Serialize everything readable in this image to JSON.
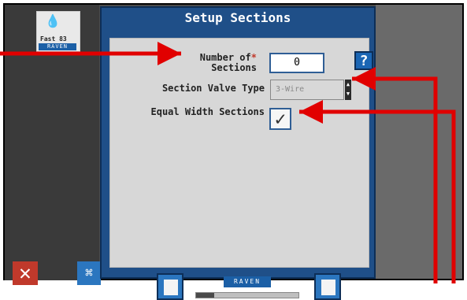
{
  "dialog": {
    "title": "Setup Sections",
    "fields": {
      "num_sections": {
        "label_line1": "Number of",
        "label_line2": "Sections",
        "required_mark": "*",
        "value": "0"
      },
      "valve_type": {
        "label": "Section Valve Type",
        "value": "3-Wire"
      },
      "equal_width": {
        "label": "Equal Width Sections",
        "checked_glyph": "✓"
      }
    },
    "help_button": {
      "label": "?"
    },
    "nav": {
      "back_icon": "back-icon",
      "next_icon": "next-icon",
      "brand": "RAVEN",
      "progress_fraction": 0.18
    }
  },
  "sidebar": {
    "logo_text_line1": "Fast 83",
    "logo_brand": "RAVEN",
    "close_icon": "x-icon",
    "tree_icon": "tree-icon"
  },
  "colors": {
    "dialog_blue": "#1f4f88",
    "accent_blue": "#2b76bf",
    "arrow_red": "#e10000"
  }
}
